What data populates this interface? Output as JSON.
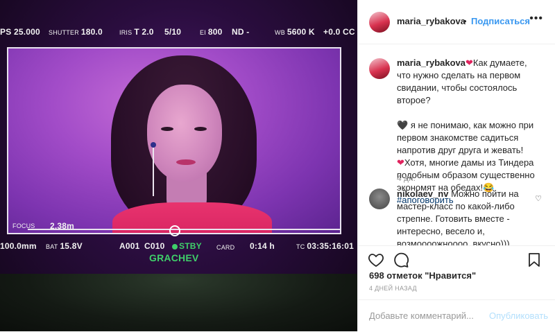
{
  "camera_hud": {
    "fps": "PS 25.000",
    "shutter_label": "SHUTTER",
    "shutter_value": "180.0",
    "iris_label": "IRIS",
    "iris_value": "T 2.0",
    "iris_fraction": "5/10",
    "ei_label": "EI",
    "ei_value": "800",
    "nd": "ND -",
    "wb_label": "WB",
    "wb_value": "5600 K",
    "cc": "+0.0 CC",
    "focus_label": "FOCUS",
    "focus_value": "2.38m",
    "lens": "100.0mm",
    "bat_label": "BAT",
    "bat_value": "15.8V",
    "reel": "A001",
    "clip": "C010",
    "status": "STBY",
    "card_label": "CARD",
    "card_value": "0:14 h",
    "tc_label": "TC",
    "tc_value": "03:35:16:01",
    "operator": "GRACHEV"
  },
  "header": {
    "username": "maria_rybakova",
    "separator": "•",
    "follow_label": "Подписаться",
    "more_icon": "more-options-icon"
  },
  "caption": {
    "username": "maria_rybakova",
    "line1": "Как думаете, что нужно сделать на первом свидании, чтобы состоялось второе?",
    "line2": "я не понимаю, как можно при первом знакомстве садиться напротив друг друга и жевать!",
    "line3": "Хотя, многие дамы из Тиндера подобным образом существенно экономят на обедах!",
    "emoji_laugh": "😂",
    "hashtag": "#апоговорить",
    "time": "4 дн."
  },
  "comment": {
    "username": "nikolaev_nv",
    "text": "Можно пойти на мастер-класс по какой-либо стрепне. Готовить вместе - интересно, весело и, возмоооожноооо, вкусно)))"
  },
  "actions": {
    "like_icon": "heart-outline-icon",
    "comment_icon": "comment-bubble-icon",
    "save_icon": "bookmark-icon"
  },
  "likes": {
    "count": "698 отметок",
    "suffix": "\"Нравится\""
  },
  "date": "4 ДНЕЙ НАЗАД",
  "add_comment": {
    "placeholder": "Добавьте комментарий...",
    "submit_label": "Опубликовать"
  },
  "colors": {
    "link_blue": "#3897f0",
    "submit_disabled": "#b2dffc",
    "heart_red": "#e0245e",
    "hashtag": "#003569",
    "stby_green": "#3fd06a"
  }
}
